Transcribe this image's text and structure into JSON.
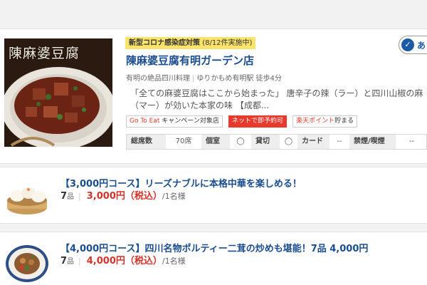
{
  "restaurant": {
    "photo_caption": "陳麻婆豆腐",
    "notice_prefix": "新型コロナ感染症対策",
    "notice_detail": "(8/12件実施中)",
    "follow_label": "あ",
    "name": "陳麻婆豆腐有明ガーデン店",
    "genre": "有明の絶品四川料理",
    "station": "ゆりかもめ有明駅 徒歩4分",
    "catch_copy": "「全ての麻婆豆腐はここから始まった」 唐辛子の辣（ラー）と四川山椒の麻（マー）が効いた本家の味 【成都...",
    "badges": {
      "goto_prefix": "Go To Eat",
      "goto_suffix": "キャンペーン対象店",
      "net_reserve": "ネットで即予約可",
      "point_prefix": "楽天ポイント",
      "point_suffix": "貯まる"
    },
    "info": {
      "seats_label": "総席数",
      "seats_value": "70席",
      "private_label": "個室",
      "private_value": "◯",
      "charter_label": "貸切",
      "charter_value": "◯",
      "card_label": "カード",
      "card_value": "--",
      "smoking_label": "禁煙/喫煙",
      "smoking_value": "--"
    }
  },
  "courses": [
    {
      "title": "【3,000円コース】リーズナブルに本格中華を楽しめる！",
      "items_count": "7",
      "items_unit": "品",
      "price": "3,000円（税込）",
      "per": "/1名様",
      "image": "steamed-dumplings"
    },
    {
      "title": "【4,000円コース】四川名物ポルティー二茸の炒めも堪能！7品 4,000円",
      "items_count": "7",
      "items_unit": "品",
      "price": "4,000円（税込）",
      "per": "/1名様",
      "image": "stir-fry-plate"
    }
  ],
  "colors": {
    "link": "#1a4d8f",
    "price": "#d4332a",
    "notice_bg": "#fae36a",
    "net_badge_bg": "#e8392d"
  }
}
